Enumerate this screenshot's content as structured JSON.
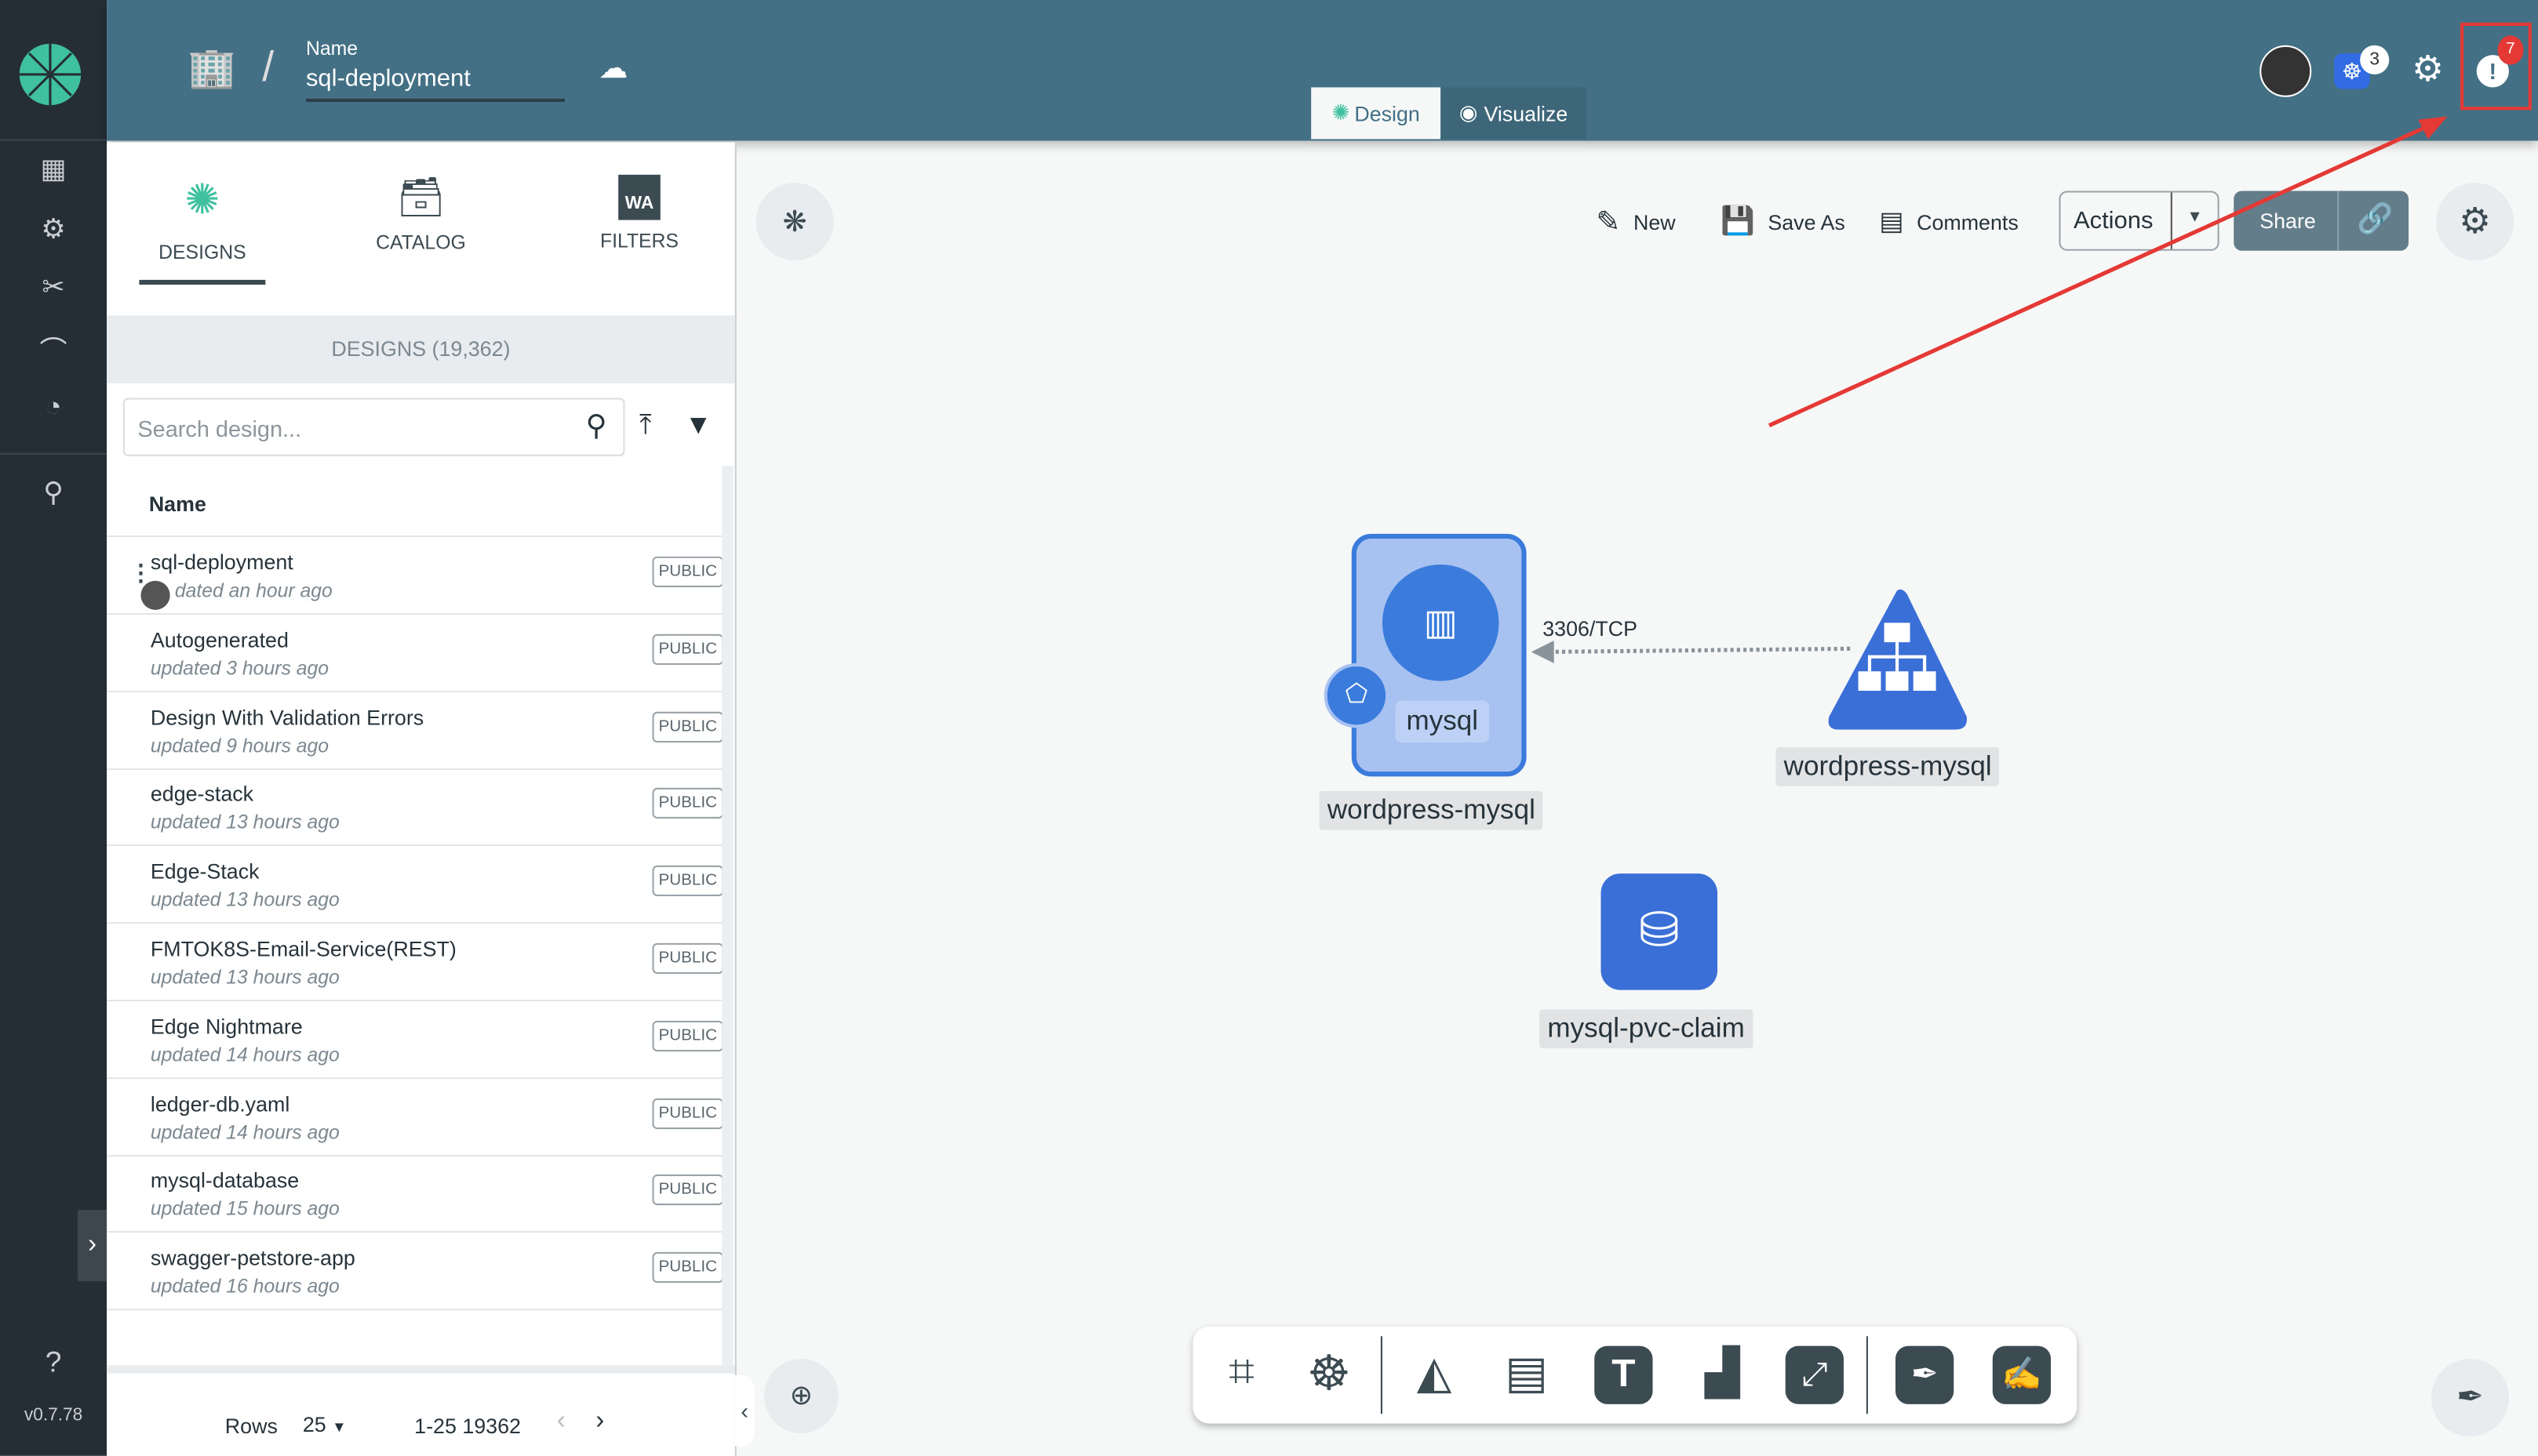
{
  "header": {
    "name_label": "Name",
    "design_name": "sql-deployment",
    "mode_tabs": [
      {
        "label": "Design",
        "active": true
      },
      {
        "label": "Visualize",
        "active": false
      }
    ],
    "k8s_badge": "3",
    "notification_badge": "7",
    "accent": "#437085",
    "alert_color": "#e53935"
  },
  "leftnav": {
    "version": "v0.7.78",
    "items": [
      "dashboard-icon",
      "settings-gears-icon",
      "tools-icon",
      "performance-icon",
      "extensions-icon",
      "location-pin-icon"
    ]
  },
  "panel": {
    "tabs": [
      {
        "label": "DESIGNS",
        "active": true
      },
      {
        "label": "CATALOG"
      },
      {
        "label": "FILTERS"
      }
    ],
    "count_label": "DESIGNS (19,362)",
    "search_placeholder": "Search design...",
    "column_header": "Name",
    "rows": [
      {
        "name": "sql-deployment",
        "sub": "dated an hour ago",
        "badge": "PUBLIC"
      },
      {
        "name": "Autogenerated",
        "sub": "updated 3 hours ago",
        "badge": "PUBLIC"
      },
      {
        "name": "Design With Validation Errors",
        "sub": "updated 9 hours ago",
        "badge": "PUBLIC"
      },
      {
        "name": "edge-stack",
        "sub": "updated 13 hours ago",
        "badge": "PUBLIC"
      },
      {
        "name": "Edge-Stack",
        "sub": "updated 13 hours ago",
        "badge": "PUBLIC"
      },
      {
        "name": "FMTOK8S-Email-Service(REST)",
        "sub": "updated 13 hours ago",
        "badge": "PUBLIC"
      },
      {
        "name": "Edge Nightmare",
        "sub": "updated 14 hours ago",
        "badge": "PUBLIC"
      },
      {
        "name": "ledger-db.yaml",
        "sub": "updated 14 hours ago",
        "badge": "PUBLIC"
      },
      {
        "name": "mysql-database",
        "sub": "updated 15 hours ago",
        "badge": "PUBLIC"
      },
      {
        "name": "swagger-petstore-app",
        "sub": "updated 16 hours ago",
        "badge": "PUBLIC"
      }
    ],
    "pagination": {
      "rows_label": "Rows",
      "rows_value": "25",
      "range": "1-25 19362"
    }
  },
  "toolbar": {
    "new": "New",
    "save_as": "Save As",
    "comments": "Comments",
    "actions": "Actions",
    "share": "Share"
  },
  "canvas": {
    "nodes": [
      {
        "inner": "mysql",
        "label": "wordpress-mysql"
      },
      {
        "label": "wordpress-mysql"
      },
      {
        "label": "mysql-pvc-claim"
      }
    ],
    "edge_label": "3306/TCP"
  }
}
